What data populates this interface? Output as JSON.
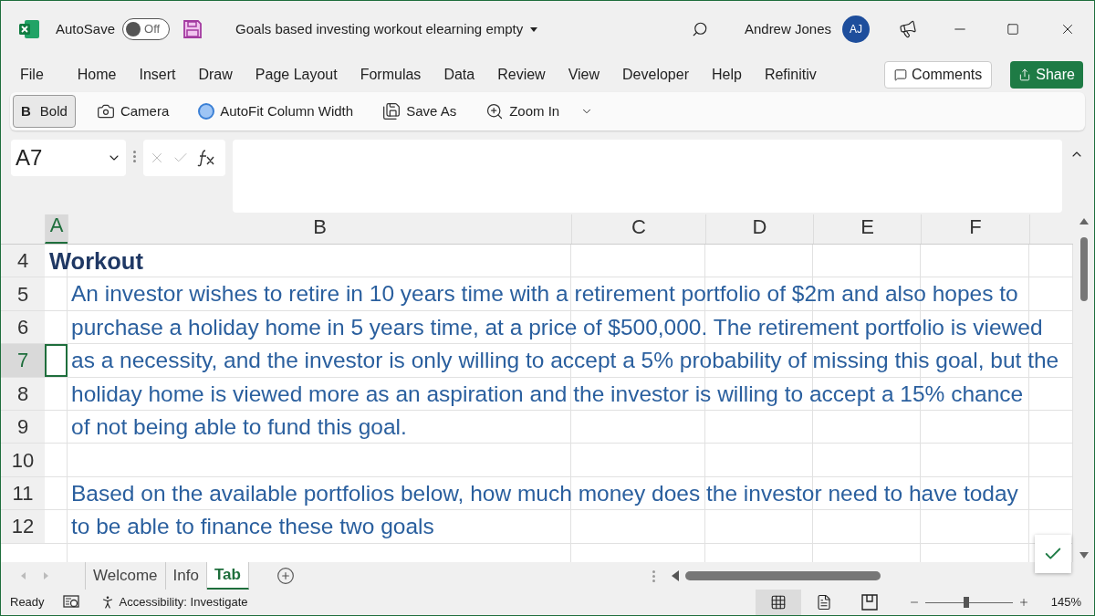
{
  "title_bar": {
    "autosave_label": "AutoSave",
    "autosave": {
      "on": false,
      "label": "Off"
    },
    "document_title": "Goals based investing workout elearning empty",
    "user_name": "Andrew Jones",
    "avatar_initials": "AJ"
  },
  "menu": [
    {
      "label": "File",
      "selected": false
    },
    {
      "label": "Home",
      "selected": false
    },
    {
      "label": "Insert",
      "selected": false
    },
    {
      "label": "Draw",
      "selected": false
    },
    {
      "label": "Page Layout",
      "selected": false
    },
    {
      "label": "Formulas",
      "selected": false
    },
    {
      "label": "Data",
      "selected": false
    },
    {
      "label": "Review",
      "selected": false
    },
    {
      "label": "View",
      "selected": false
    },
    {
      "label": "Developer",
      "selected": false
    },
    {
      "label": "Help",
      "selected": false
    },
    {
      "label": "Refinitiv",
      "selected": false
    }
  ],
  "comments_button": "Comments",
  "share_button": "Share",
  "quick_toolbar": [
    {
      "kind": "bold",
      "icon": "B",
      "label": "Bold",
      "selected": true
    },
    {
      "kind": "camera",
      "label": "Camera",
      "selected": false
    },
    {
      "kind": "autofit",
      "label": "AutoFit Column Width",
      "selected": false
    },
    {
      "kind": "saveas",
      "label": "Save As",
      "selected": false
    },
    {
      "kind": "zoom",
      "label": "Zoom In",
      "selected": false
    }
  ],
  "name_box": "A7",
  "columns": [
    {
      "label": "A",
      "selected": true
    },
    {
      "label": "B",
      "selected": false
    },
    {
      "label": "C",
      "selected": false
    },
    {
      "label": "D",
      "selected": false
    },
    {
      "label": "E",
      "selected": false
    },
    {
      "label": "F",
      "selected": false
    }
  ],
  "rows": [
    {
      "number": "4",
      "kind": "heading",
      "text": "Workout",
      "selected": false
    },
    {
      "number": "5",
      "kind": "body",
      "text": "An investor wishes to retire in 10 years time with a retirement portfolio of $2m and also hopes to",
      "selected": false
    },
    {
      "number": "6",
      "kind": "body",
      "text": "purchase a holiday home in 5 years time, at a price of $500,000. The retirement portfolio is viewed",
      "selected": false
    },
    {
      "number": "7",
      "kind": "body",
      "text": "as a necessity, and the investor is only willing to accept a 5% probability of missing this goal, but the",
      "selected": true
    },
    {
      "number": "8",
      "kind": "body",
      "text": "holiday home is viewed more as an aspiration and the investor is willing to accept a 15% chance",
      "selected": false
    },
    {
      "number": "9",
      "kind": "body",
      "text": "of not being able to fund this goal.",
      "selected": false
    },
    {
      "number": "10",
      "selected": false
    },
    {
      "number": "11",
      "kind": "body",
      "text": "Based on the available portfolios below, how much money does the investor need to have today",
      "selected": false
    },
    {
      "number": "12",
      "kind": "body",
      "text": "to be able to finance these two goals",
      "selected": false
    }
  ],
  "sheet_tabs": [
    {
      "label": "Welcome",
      "selected": false
    },
    {
      "label": "Info",
      "selected": false
    },
    {
      "label": "Tab",
      "selected": true
    }
  ],
  "status_bar": {
    "status": "Ready",
    "accessibility": "Accessibility: Investigate",
    "views": [
      {
        "kind": "normal",
        "selected": true
      },
      {
        "kind": "page",
        "selected": false
      },
      {
        "kind": "break",
        "selected": false
      }
    ],
    "zoom": {
      "level": 0.47,
      "label": "145%"
    }
  }
}
